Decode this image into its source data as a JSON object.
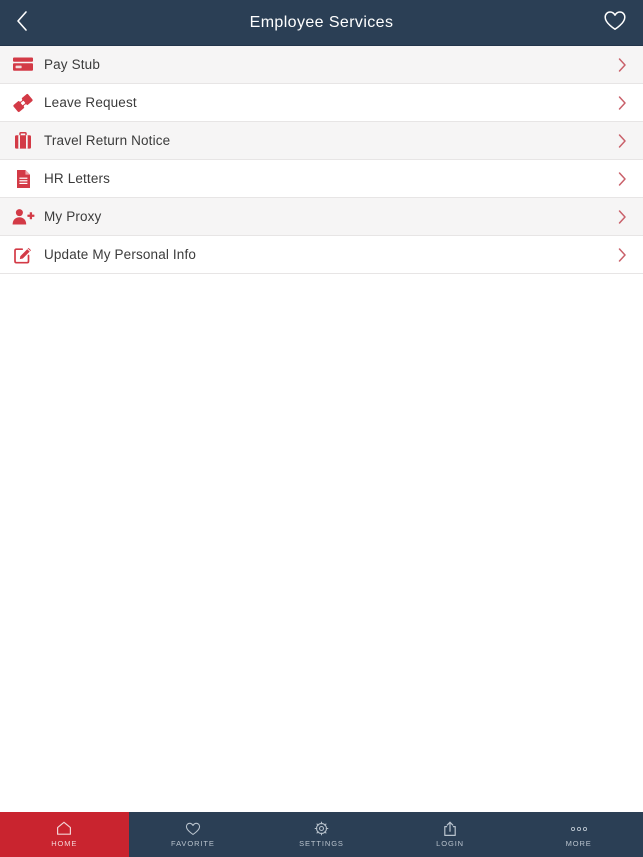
{
  "header": {
    "title": "Employee Services",
    "back_icon": "chevron-left-icon",
    "favorite_icon": "heart-outline-icon",
    "background_color": "#2b3f55",
    "text_color": "#ffffff"
  },
  "theme": {
    "accent_red": "#c9242f",
    "icon_red": "#d33a46",
    "navy": "#2b3f55",
    "row_alt_background": "#f6f5f5",
    "row_background": "#ffffff",
    "divider": "#e7e5e5",
    "label_color": "#3b3b3b",
    "chevron_color": "#c9606a"
  },
  "menu": {
    "items": [
      {
        "label": "Pay Stub",
        "icon": "credit-card-icon",
        "chevron": "chevron-right-icon"
      },
      {
        "label": "Leave Request",
        "icon": "ticket-icon",
        "chevron": "chevron-right-icon"
      },
      {
        "label": "Travel Return Notice",
        "icon": "briefcase-icon",
        "chevron": "chevron-right-icon"
      },
      {
        "label": "HR Letters",
        "icon": "document-icon",
        "chevron": "chevron-right-icon"
      },
      {
        "label": "My Proxy",
        "icon": "user-plus-icon",
        "chevron": "chevron-right-icon"
      },
      {
        "label": "Update My Personal Info",
        "icon": "edit-pencil-square-icon",
        "chevron": "chevron-right-icon"
      }
    ]
  },
  "tabbar": {
    "items": [
      {
        "label": "HOME",
        "icon": "home-icon",
        "active": true
      },
      {
        "label": "FAVORITE",
        "icon": "heart-outline-icon",
        "active": false
      },
      {
        "label": "SETTINGS",
        "icon": "gear-icon",
        "active": false
      },
      {
        "label": "LOGIN",
        "icon": "share-upload-icon",
        "active": false
      },
      {
        "label": "MORE",
        "icon": "ellipsis-icon",
        "active": false
      }
    ]
  }
}
